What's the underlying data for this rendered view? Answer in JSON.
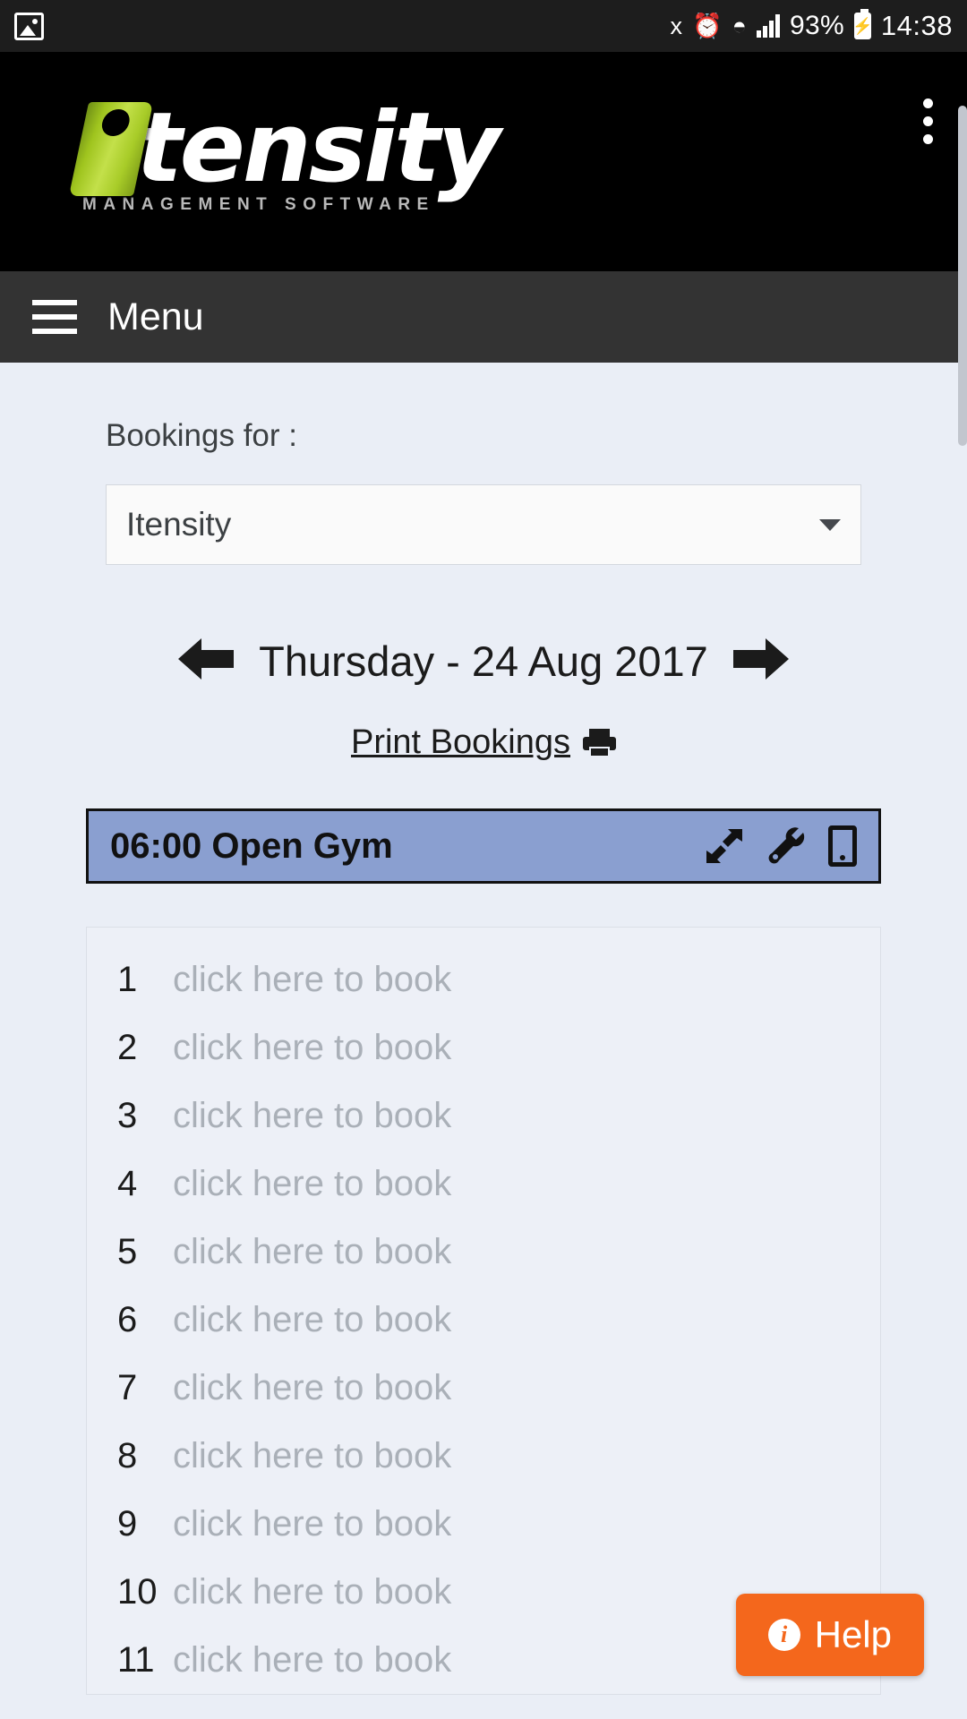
{
  "status_bar": {
    "left_icon": "image-icon",
    "icons": [
      "bluetooth-icon",
      "alarm-icon",
      "wifi-icon",
      "signal-icon"
    ],
    "battery_percent": "93%",
    "battery_icon": "battery-charging-icon",
    "time": "14:38"
  },
  "header": {
    "brand_word": "tensity",
    "brand_letter": "i",
    "tagline": "MANAGEMENT SOFTWARE",
    "overflow_icon": "kebab-menu-icon",
    "background": "#000000",
    "accent": "#a8cc28"
  },
  "menu_bar": {
    "label": "Menu",
    "icon": "hamburger-icon",
    "background": "#333333"
  },
  "main": {
    "bookings_for_label": "Bookings for :",
    "venue_select": {
      "value": "Itensity",
      "caret_icon": "chevron-down-icon"
    },
    "date_nav": {
      "prev_icon": "arrow-left-icon",
      "date_text": "Thursday - 24 Aug 2017",
      "next_icon": "arrow-right-icon"
    },
    "print_link": {
      "label": "Print Bookings",
      "icon": "printer-icon"
    },
    "slot": {
      "title": "06:00 Open Gym",
      "background": "#8a9fd0",
      "icons": [
        "collapse-arrows-icon",
        "wrench-icon",
        "tablet-icon"
      ]
    },
    "booking_rows": [
      {
        "num": "1",
        "text": "click here to book"
      },
      {
        "num": "2",
        "text": "click here to book"
      },
      {
        "num": "3",
        "text": "click here to book"
      },
      {
        "num": "4",
        "text": "click here to book"
      },
      {
        "num": "5",
        "text": "click here to book"
      },
      {
        "num": "6",
        "text": "click here to book"
      },
      {
        "num": "7",
        "text": "click here to book"
      },
      {
        "num": "8",
        "text": "click here to book"
      },
      {
        "num": "9",
        "text": "click here to book"
      },
      {
        "num": "10",
        "text": "click here to book"
      },
      {
        "num": "11",
        "text": "click here to book"
      }
    ]
  },
  "help_button": {
    "label": "Help",
    "icon": "info-icon",
    "color": "#f4671c"
  }
}
